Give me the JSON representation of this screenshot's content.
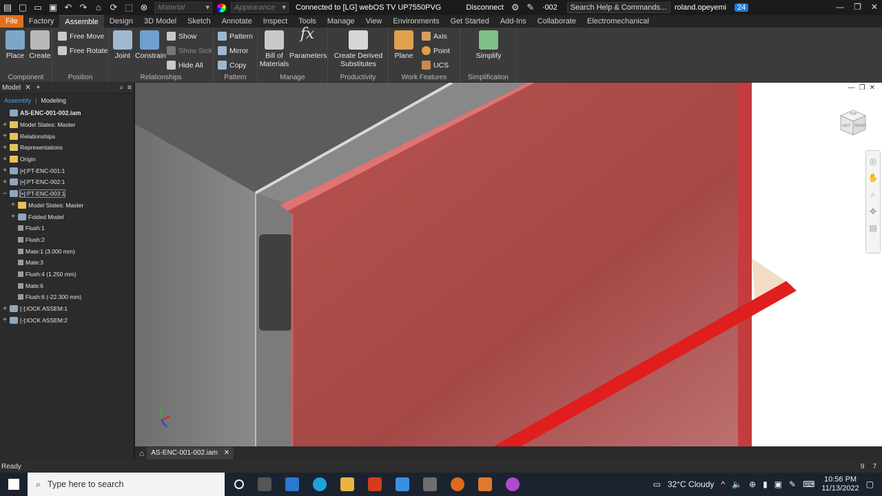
{
  "qat": {
    "material_placeholder": "Material",
    "appearance_placeholder": "Appearance",
    "connection": "Connected to [LG] webOS TV UP7550PVG",
    "disconnect": "Disconnect",
    "doc_suffix": "·002",
    "search": "Search Help & Commands...",
    "user": "roland.opeyemi",
    "badge": "24"
  },
  "tabs": [
    "File",
    "Factory",
    "Assemble",
    "Design",
    "3D Model",
    "Sketch",
    "Annotate",
    "Inspect",
    "Tools",
    "Manage",
    "View",
    "Environments",
    "Get Started",
    "Add-Ins",
    "Collaborate",
    "Electromechanical"
  ],
  "ribbon": {
    "component": {
      "title": "Component",
      "place": "Place",
      "create": "Create"
    },
    "position": {
      "title": "Position",
      "free_move": "Free Move",
      "free_rotate": "Free Rotate"
    },
    "relationships": {
      "title": "Relationships",
      "joint": "Joint",
      "constrain": "Constrain",
      "show": "Show",
      "show_sick": "Show Sick",
      "hide_all": "Hide All"
    },
    "pattern": {
      "title": "Pattern",
      "pattern": "Pattern",
      "mirror": "Mirror",
      "copy": "Copy"
    },
    "manage": {
      "title": "Manage",
      "bom": "Bill of Materials",
      "parameters": "Parameters"
    },
    "productivity": {
      "title": "Productivity",
      "derived": "Create Derived Substitutes"
    },
    "work_features": {
      "title": "Work Features",
      "plane": "Plane",
      "axis": "Axis",
      "point": "Point",
      "ucs": "UCS"
    },
    "simplification": {
      "title": "Simplification",
      "simplify": "Simplify"
    }
  },
  "browser": {
    "title": "Model",
    "sub_assembly": "Assembly",
    "sub_modeling": "Modeling",
    "nodes": [
      {
        "label": "AS-ENC-001-002.iam",
        "level": 0,
        "pm": "",
        "icon": "part"
      },
      {
        "label": "Model States: Master",
        "level": 0,
        "pm": "+",
        "icon": "folder"
      },
      {
        "label": "Relationships",
        "level": 0,
        "pm": "+",
        "icon": "folder"
      },
      {
        "label": "Representations",
        "level": 0,
        "pm": "+",
        "icon": "folder"
      },
      {
        "label": "Origin",
        "level": 0,
        "pm": "+",
        "icon": "folder"
      },
      {
        "label": "[•]:PT-ENC-001:1",
        "level": 0,
        "pm": "+",
        "icon": "part"
      },
      {
        "label": "[•]:PT-ENC-002:1",
        "level": 0,
        "pm": "+",
        "icon": "part"
      },
      {
        "label": "[•]:PT-ENC-003:1",
        "level": 0,
        "pm": "−",
        "icon": "part"
      },
      {
        "label": "Model States: Master",
        "level": 1,
        "pm": "+",
        "icon": "folder"
      },
      {
        "label": "Folded Model",
        "level": 1,
        "pm": "+",
        "icon": "part"
      },
      {
        "label": "Flush:1",
        "level": 1,
        "pm": "",
        "icon": "rel"
      },
      {
        "label": "Flush:2",
        "level": 1,
        "pm": "",
        "icon": "rel"
      },
      {
        "label": "Mate:1 (3.000 mm)",
        "level": 1,
        "pm": "",
        "icon": "rel"
      },
      {
        "label": "Mate:3",
        "level": 1,
        "pm": "",
        "icon": "rel"
      },
      {
        "label": "Flush:4 (1.250 mm)",
        "level": 1,
        "pm": "",
        "icon": "rel"
      },
      {
        "label": "Mate:6",
        "level": 1,
        "pm": "",
        "icon": "rel"
      },
      {
        "label": "Flush:6 (-22.300 mm)",
        "level": 1,
        "pm": "",
        "icon": "rel"
      },
      {
        "label": "[-]:lOCK ASSEM:1",
        "level": 0,
        "pm": "+",
        "icon": "part"
      },
      {
        "label": "[-]:lOCK ASSEM:2",
        "level": 0,
        "pm": "+",
        "icon": "part"
      }
    ]
  },
  "viewcube": {
    "top": "TOP",
    "left": "LEFT",
    "front": "FRONT"
  },
  "document_tab": "AS-ENC-001-002.iam",
  "status": {
    "text": "Ready",
    "count_a": "9",
    "count_b": "7"
  },
  "taskbar": {
    "search_placeholder": "Type here to search",
    "weather": "32°C  Cloudy",
    "time": "10:56 PM",
    "date": "11/13/2022"
  }
}
